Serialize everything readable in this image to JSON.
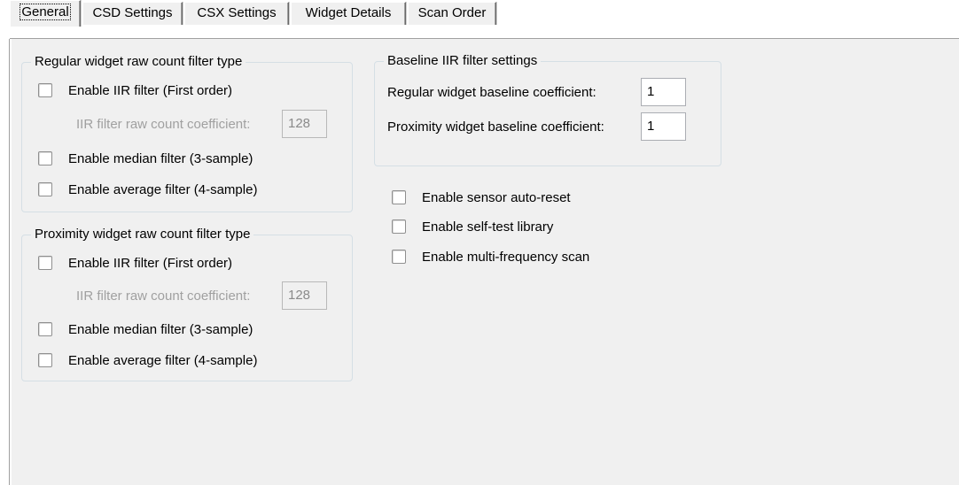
{
  "tabs": [
    {
      "label": "General",
      "active": true
    },
    {
      "label": "CSD Settings",
      "active": false
    },
    {
      "label": "CSX Settings",
      "active": false
    },
    {
      "label": "Widget Details",
      "active": false
    },
    {
      "label": "Scan Order",
      "active": false
    }
  ],
  "regular_filter": {
    "title": "Regular widget raw count filter type",
    "iir_label": "Enable IIR filter (First order)",
    "iir_checked": false,
    "coeff_label": "IIR filter raw count coefficient:",
    "coeff_value": "128",
    "median_label": "Enable median filter (3-sample)",
    "median_checked": false,
    "average_label": "Enable average filter (4-sample)",
    "average_checked": false
  },
  "proximity_filter": {
    "title": "Proximity widget raw count filter type",
    "iir_label": "Enable IIR filter (First order)",
    "iir_checked": false,
    "coeff_label": "IIR filter raw count coefficient:",
    "coeff_value": "128",
    "median_label": "Enable median filter (3-sample)",
    "median_checked": false,
    "average_label": "Enable average filter (4-sample)",
    "average_checked": false
  },
  "baseline": {
    "title": "Baseline IIR filter settings",
    "regular_label": "Regular widget baseline coefficient:",
    "regular_value": "1",
    "proximity_label": "Proximity widget baseline coefficient:",
    "proximity_value": "1"
  },
  "options": {
    "auto_reset_label": "Enable sensor auto-reset",
    "auto_reset_checked": false,
    "self_test_label": "Enable self-test library",
    "self_test_checked": false,
    "multi_freq_label": "Enable multi-frequency scan",
    "multi_freq_checked": false
  }
}
